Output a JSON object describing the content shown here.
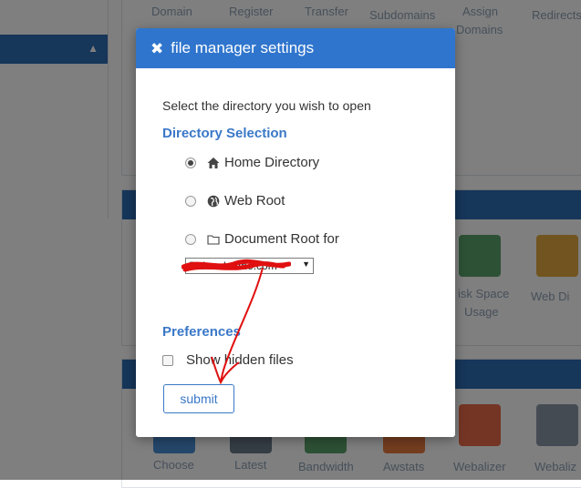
{
  "background": {
    "top_labels": [
      {
        "text": "Domain"
      },
      {
        "text": "Register"
      },
      {
        "text": "Transfer"
      },
      {
        "text": "Subdomains"
      },
      {
        "text": "Assign"
      },
      {
        "text": "Redirects"
      }
    ],
    "top_labels_line2": [
      "Domains"
    ],
    "mid_labels": [
      "isk Space",
      "Usage",
      "Web Di"
    ],
    "bottom_labels": [
      "Choose",
      "Latest",
      "Bandwidth",
      "Awstats",
      "Webalizer",
      "Webaliz"
    ],
    "colors": {
      "header_blue": "#2d6db5"
    }
  },
  "modal": {
    "title": "file manager settings",
    "close_icon": "x-icon",
    "intro": "Select the directory you wish to open",
    "directory_section": {
      "title": "Directory Selection",
      "options": [
        {
          "label": "Home Directory",
          "icon": "home-icon",
          "selected": true
        },
        {
          "label": "Web Root",
          "icon": "globe-icon",
          "selected": false
        },
        {
          "label": "Document Root for",
          "icon": "folder-icon",
          "selected": false
        }
      ],
      "domain_select": {
        "value": "fictionalname.com"
      }
    },
    "preferences_section": {
      "title": "Preferences",
      "show_hidden_files": {
        "label": "Show hidden files",
        "checked": false
      }
    },
    "submit_label": "submit",
    "colors": {
      "header": "#2f75cd",
      "accent": "#3a78c8",
      "annotation": "#e01010"
    }
  }
}
